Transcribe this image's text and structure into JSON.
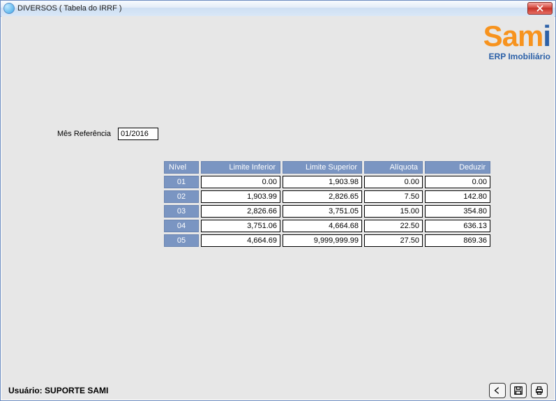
{
  "window": {
    "title": "DIVERSOS ( Tabela do IRRF )"
  },
  "logo": {
    "brand_orange": "Sam",
    "brand_blue": "i",
    "tagline": "ERP Imobiliário"
  },
  "reference": {
    "label": "Mês Referência",
    "value": "01/2016"
  },
  "table": {
    "headers": {
      "nivel": "Nível",
      "li": "Limite Inferior",
      "ls": "Limite Superior",
      "aliquota": "Alíquota",
      "deduzir": "Deduzir"
    },
    "rows": [
      {
        "nivel": "01",
        "li": "0.00",
        "ls": "1,903.98",
        "aliquota": "0.00",
        "deduzir": "0.00"
      },
      {
        "nivel": "02",
        "li": "1,903.99",
        "ls": "2,826.65",
        "aliquota": "7.50",
        "deduzir": "142.80"
      },
      {
        "nivel": "03",
        "li": "2,826.66",
        "ls": "3,751.05",
        "aliquota": "15.00",
        "deduzir": "354.80"
      },
      {
        "nivel": "04",
        "li": "3,751.06",
        "ls": "4,664.68",
        "aliquota": "22.50",
        "deduzir": "636.13"
      },
      {
        "nivel": "05",
        "li": "4,664.69",
        "ls": "9,999,999.99",
        "aliquota": "27.50",
        "deduzir": "869.36"
      }
    ]
  },
  "footer": {
    "user_prefix": "Usuário:",
    "user_name": "SUPORTE SAMI"
  }
}
